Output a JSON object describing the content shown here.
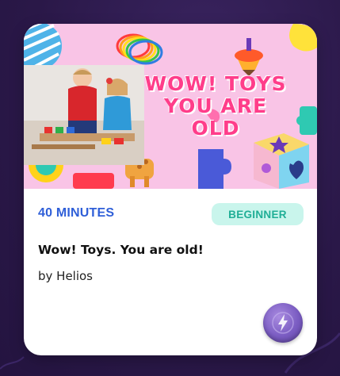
{
  "card": {
    "banner_title": "WOW! TOYS\nYOU ARE OLD",
    "duration": "40 MINUTES",
    "level": "BEGINNER",
    "title": "Wow! Toys. You are old!",
    "author": "by Helios"
  },
  "colors": {
    "page_background": "#2a1848",
    "banner_background": "#f9c4e6",
    "banner_title": "#ff3d8a",
    "duration_text": "#2f5fd8",
    "badge_background": "#c9f5ec",
    "badge_text": "#1fae96",
    "action_button": "#7a5cc2"
  },
  "icons": {
    "action_button": "lightning-bolt-icon"
  }
}
